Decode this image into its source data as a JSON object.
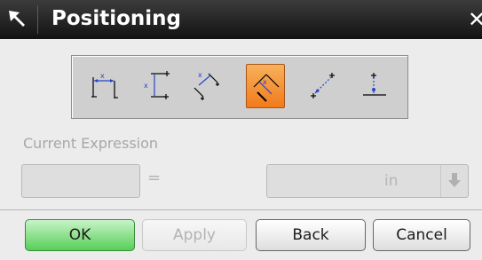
{
  "dialog": {
    "title": "Positioning",
    "close_glyph": "✕"
  },
  "toolbar": {
    "tools": [
      {
        "name": "horizontal-dimension",
        "icon": "horizontal-dimension-icon",
        "active": false
      },
      {
        "name": "vertical-dimension",
        "icon": "vertical-dimension-icon",
        "active": false
      },
      {
        "name": "parallel-dimension",
        "icon": "parallel-dimension-icon",
        "active": false
      },
      {
        "name": "perpendicular-dimension",
        "icon": "perpendicular-dimension-icon",
        "active": true
      },
      {
        "name": "point-onto-point",
        "icon": "point-onto-point-icon",
        "active": false
      },
      {
        "name": "point-onto-line",
        "icon": "point-onto-line-icon",
        "active": false
      }
    ],
    "active_color": "#f27a1b"
  },
  "expression": {
    "label": "Current Expression",
    "value": "",
    "equals": "=",
    "unit": "in"
  },
  "buttons": {
    "ok": "OK",
    "apply": "Apply",
    "back": "Back",
    "cancel": "Cancel"
  },
  "colors": {
    "titlebar": "#1a1a1a",
    "ok": "#57cf57",
    "panel": "#ececec"
  }
}
